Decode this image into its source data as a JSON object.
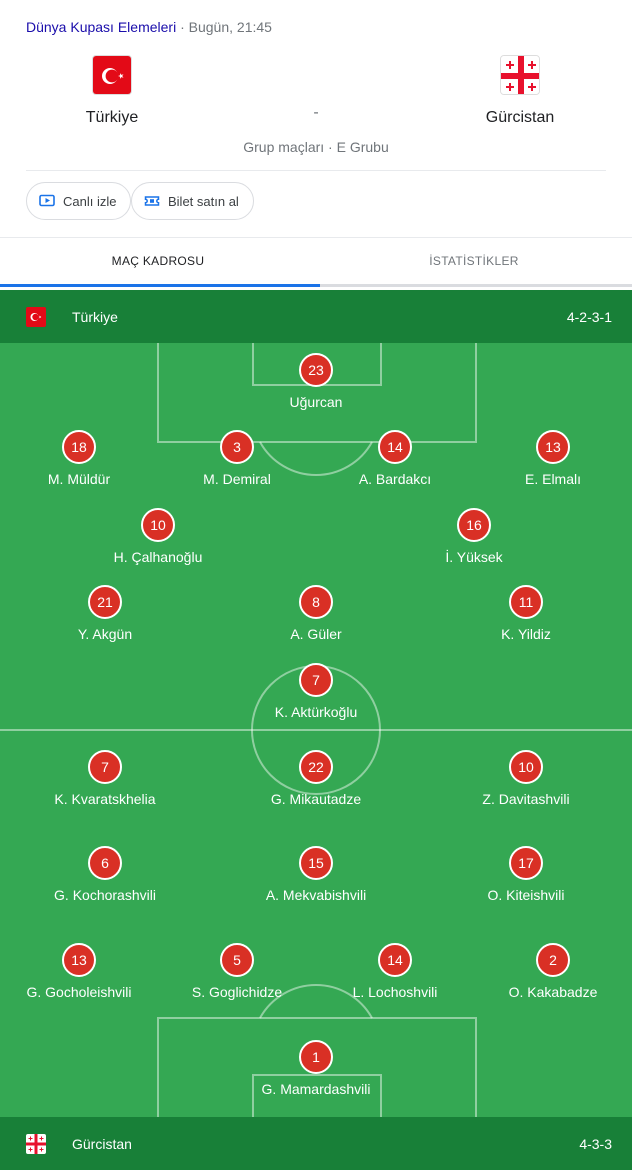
{
  "header": {
    "competition": "Dünya Kupası Elemeleri",
    "separator": " · ",
    "time": "Bugün, 21:45"
  },
  "match": {
    "home_team": "Türkiye",
    "away_team": "Gürcistan",
    "score": "-",
    "group": "Grup maçları · E Grubu"
  },
  "actions": {
    "watch_label": "Canlı izle",
    "tickets_label": "Bilet satın al"
  },
  "tabs": {
    "lineup": "MAÇ KADROSU",
    "stats": "İSTATİSTİKLER"
  },
  "home_bar": {
    "name": "Türkiye",
    "formation": "4-2-3-1"
  },
  "away_bar": {
    "name": "Gürcistan",
    "formation": "4-3-3"
  },
  "colors": {
    "pitch": "#34a853",
    "team_bar": "#188038",
    "player_badge": "#d93025",
    "link": "#1a0dab"
  },
  "home_players": [
    {
      "number": "23",
      "name": "Uğurcan"
    },
    {
      "number": "18",
      "name": "M. Müldür"
    },
    {
      "number": "3",
      "name": "M. Demiral"
    },
    {
      "number": "14",
      "name": "A. Bardakcı"
    },
    {
      "number": "13",
      "name": "E. Elmalı"
    },
    {
      "number": "10",
      "name": "H. Çalhanoğlu"
    },
    {
      "number": "16",
      "name": "İ. Yüksek"
    },
    {
      "number": "21",
      "name": "Y. Akgün"
    },
    {
      "number": "8",
      "name": "A. Güler"
    },
    {
      "number": "11",
      "name": "K. Yildiz"
    },
    {
      "number": "7",
      "name": "K. Aktürkoğlu"
    }
  ],
  "away_players": [
    {
      "number": "7",
      "name": "K. Kvaratskhelia"
    },
    {
      "number": "22",
      "name": "G. Mikautadze"
    },
    {
      "number": "10",
      "name": "Z. Davitashvili"
    },
    {
      "number": "6",
      "name": "G. Kochorashvili"
    },
    {
      "number": "15",
      "name": "A. Mekvabishvili"
    },
    {
      "number": "17",
      "name": "O. Kiteishvili"
    },
    {
      "number": "13",
      "name": "G. Gocholeishvili"
    },
    {
      "number": "5",
      "name": "S. Goglichidze"
    },
    {
      "number": "14",
      "name": "L. Lochoshvili"
    },
    {
      "number": "2",
      "name": "O. Kakabadze"
    },
    {
      "number": "1",
      "name": "G. Mamardashvili"
    }
  ]
}
